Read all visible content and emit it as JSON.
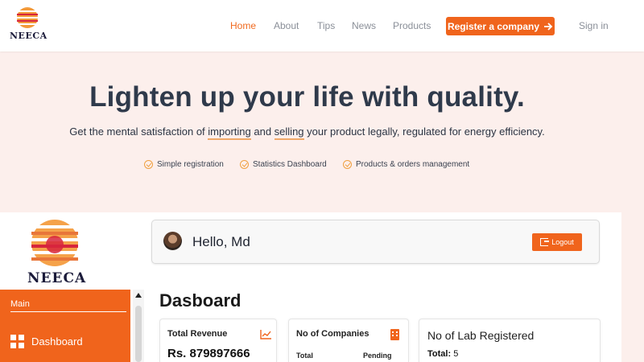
{
  "brand": {
    "name": "NEECA"
  },
  "nav": {
    "links": [
      "Home",
      "About",
      "Tips",
      "News",
      "Products"
    ],
    "active": "Home",
    "register_label": "Register a company",
    "signin_label": "Sign in"
  },
  "hero": {
    "title": "Lighten up your life with quality.",
    "sub_prefix": "Get the mental satisfaction of ",
    "sub_word1": "importing",
    "sub_and": " and ",
    "sub_word2": "selling",
    "sub_suffix": " your product legally, regulated for energy efficiency.",
    "features": [
      "Simple registration",
      "Statistics Dashboard",
      "Products & orders management"
    ]
  },
  "dashboard": {
    "sidebar_section": "Main",
    "sidebar_item": "Dashboard",
    "greeting": "Hello, Md",
    "logout_label": "Logout",
    "title": "Dasboard",
    "cards": {
      "revenue_label": "Total Revenue",
      "revenue_value": "Rs. 879897666",
      "companies_label": "No of Companies",
      "companies_total": "Total",
      "companies_pending": "Pending",
      "labs_label": "No of Lab Registered",
      "labs_total_label": "Total:",
      "labs_total_value": "5"
    }
  },
  "colors": {
    "accent": "#f0641c",
    "hero_bg": "#fcefec",
    "text": "#2f3a4b"
  },
  "icons": [
    "logo-mark",
    "arrow-right-icon",
    "check-circle-icon",
    "grid-icon",
    "logout-icon",
    "trend-chart-icon",
    "building-icon",
    "avatar"
  ]
}
